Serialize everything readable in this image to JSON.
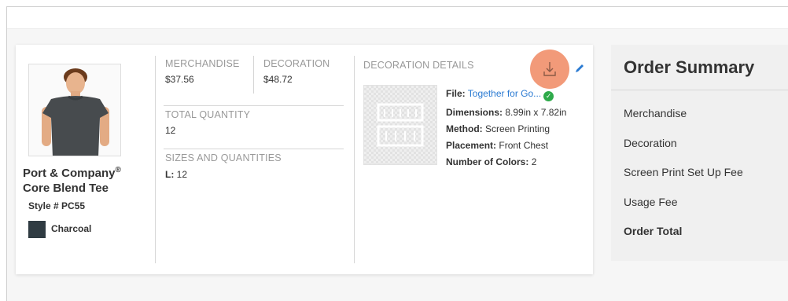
{
  "product": {
    "name": "Port & Company",
    "name_mark": "®",
    "name_line2": "Core Blend Tee",
    "style": "Style # PC55",
    "color_name": "Charcoal",
    "color_hex": "#2f3b42"
  },
  "pricing": {
    "merchandise_label": "MERCHANDISE",
    "merchandise_value": "$37.56",
    "decoration_label": "DECORATION",
    "decoration_value": "$48.72",
    "total_quantity_label": "TOTAL QUANTITY",
    "total_quantity_value": "12",
    "sizes_label": "SIZES AND QUANTITIES",
    "size_key": "L:",
    "size_value": "12"
  },
  "decoration_details": {
    "heading": "DECORATION DETAILS",
    "file_label": "File:",
    "file_value": "Together for Go...",
    "dimensions_label": "Dimensions:",
    "dimensions_value": "8.99in x 7.82in",
    "method_label": "Method:",
    "method_value": "Screen Printing",
    "placement_label": "Placement:",
    "placement_value": "Front Chest",
    "colors_label": "Number of Colors:",
    "colors_value": "2",
    "download_icon": "download-icon",
    "edit_icon": "pencil-icon"
  },
  "order_summary": {
    "title": "Order Summary",
    "rows": [
      "Merchandise",
      "Decoration",
      "Screen Print Set Up Fee",
      "Usage Fee"
    ],
    "total_label": "Order Total"
  },
  "colors": {
    "link": "#2a7ad2",
    "accent_highlight": "#f29a79",
    "success": "#2eaa4a"
  }
}
